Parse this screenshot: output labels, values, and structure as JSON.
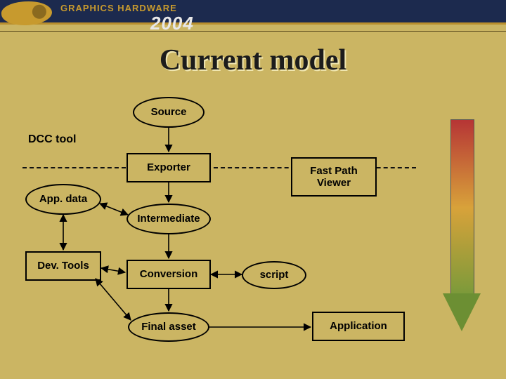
{
  "banner": {
    "conference_name": "GRAPHICS HARDWARE",
    "year": "2004"
  },
  "title": "Current model",
  "labels": {
    "dcc_tool": "DCC tool"
  },
  "nodes": {
    "source": "Source",
    "exporter": "Exporter",
    "intermediate": "Intermediate",
    "conversion": "Conversion",
    "final_asset": "Final asset",
    "app_data": "App. data",
    "dev_tools": "Dev. Tools",
    "fast_path_viewer": "Fast Path\nViewer",
    "script": "script",
    "application": "Application"
  },
  "edges": [
    {
      "from": "source",
      "to": "exporter",
      "style": "fwd"
    },
    {
      "from": "exporter",
      "to": "intermediate",
      "style": "fwd"
    },
    {
      "from": "intermediate",
      "to": "conversion",
      "style": "fwd"
    },
    {
      "from": "conversion",
      "to": "final_asset",
      "style": "fwd"
    },
    {
      "from": "app_data",
      "to": "intermediate",
      "style": "dbl"
    },
    {
      "from": "app_data",
      "to": "dev_tools",
      "style": "dbl"
    },
    {
      "from": "dev_tools",
      "to": "conversion",
      "style": "dbl"
    },
    {
      "from": "dev_tools",
      "to": "final_asset",
      "style": "dbl"
    },
    {
      "from": "conversion",
      "to": "script",
      "style": "dbl"
    },
    {
      "from": "final_asset",
      "to": "application",
      "style": "fwd"
    }
  ],
  "colors": {
    "background": "#cbb563",
    "banner_navy": "#1c2a4e",
    "banner_gold": "#b98f2d",
    "arrow_gradient": [
      "#b63535",
      "#d8a23a",
      "#7a9a3a"
    ]
  }
}
